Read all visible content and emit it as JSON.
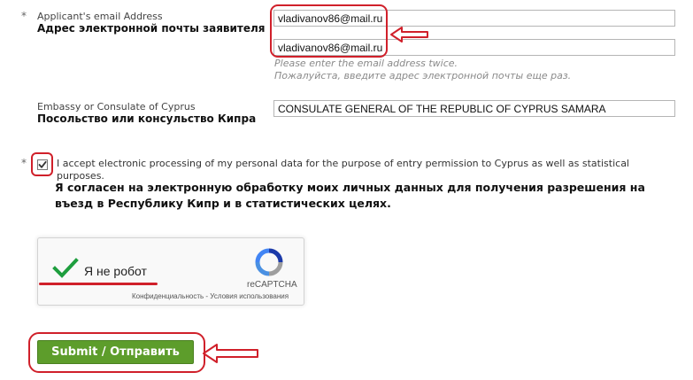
{
  "form": {
    "email": {
      "required_mark": "*",
      "label_en": "Applicant's email Address",
      "label_ru": "Адрес электронной почты заявителя",
      "value1": "vladivanov86@mail.ru",
      "value2": "vladivanov86@mail.ru",
      "hint_en": "Please enter the email address twice.",
      "hint_ru": "Пожалуйста, введите адрес электронной почты еще раз."
    },
    "embassy": {
      "label_en": "Embassy or Consulate of Cyprus",
      "label_ru": "Посольство или консульство Кипра",
      "value": "CONSULATE GENERAL OF THE REPUBLIC OF CYPRUS SAMARA"
    },
    "consent": {
      "required_mark": "*",
      "checked": true,
      "text_en": "I accept electronic processing of my personal data for the purpose of entry permission to Cyprus as well as statistical purposes.",
      "text_ru": "Я согласен на электронную обработку моих личных данных для получения разрешения на въезд в Республику Кипр и в статистических целях."
    },
    "captcha": {
      "label": "Я не робот",
      "brand": "reCAPTCHA",
      "privacy": "Конфиденциальность",
      "separator": " - ",
      "terms": "Условия использования"
    },
    "submit_label": "Submit / Отправить"
  },
  "colors": {
    "annotation_red": "#d0202a",
    "submit_green": "#5d9d2b",
    "check_green": "#1e9e3e",
    "hint_gray": "#8a8a8a"
  }
}
